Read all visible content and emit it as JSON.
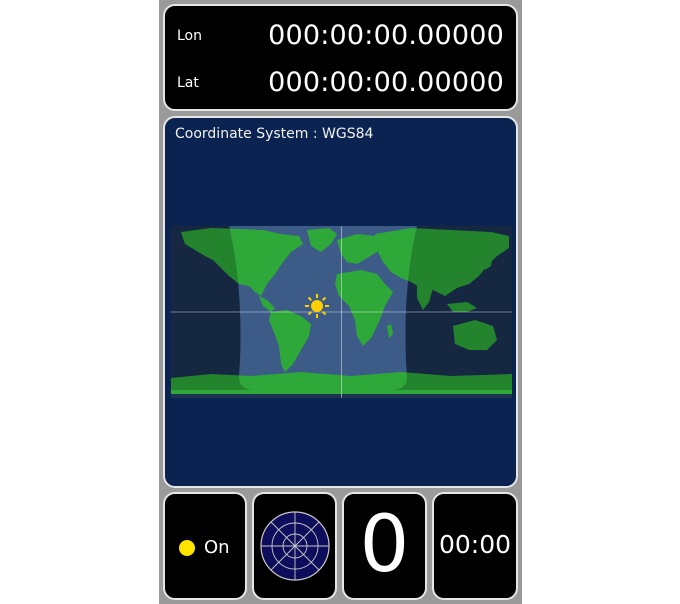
{
  "coordinates": {
    "lon_label": "Lon",
    "lon_value": "000:00:00.00000",
    "lat_label": "Lat",
    "lat_value": "000:00:00.00000"
  },
  "map": {
    "coordinate_system_text": "Coordinate System : WGS84"
  },
  "status": {
    "gps_label": "On",
    "gps_indicator_color": "#ffe400",
    "satellite_count": "0",
    "timer": "00:00"
  },
  "colors": {
    "map_background": "#0a2350",
    "land": "#2fa83a",
    "sun": "#ffd000"
  },
  "icons": {
    "sun": "sun-icon",
    "radar": "satellite-radar-icon"
  }
}
